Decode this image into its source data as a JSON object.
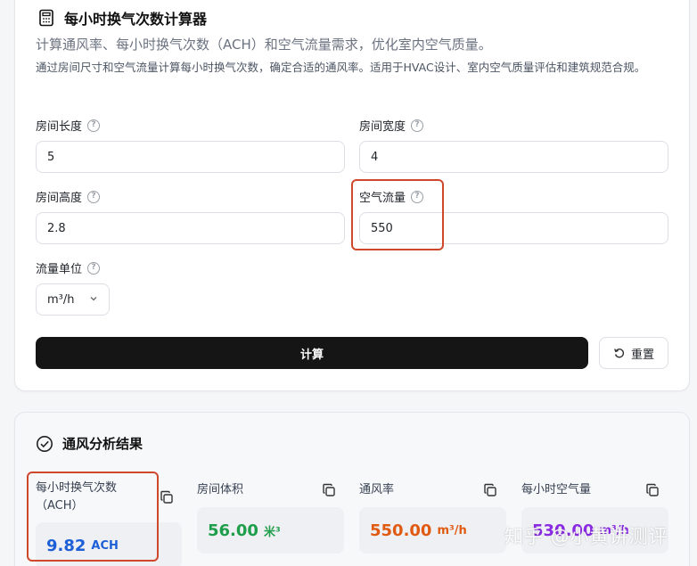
{
  "header": {
    "title": "每小时换气次数计算器",
    "subtitle": "计算通风率、每小时换气次数（ACH）和空气流量需求，优化室内空气质量。",
    "description": "通过房间尺寸和空气流量计算每小时换气次数，确定合适的通风率。适用于HVAC设计、室内空气质量评估和建筑规范合规。"
  },
  "form": {
    "length": {
      "label": "房间长度",
      "value": "5"
    },
    "width": {
      "label": "房间宽度",
      "value": "4"
    },
    "height": {
      "label": "房间高度",
      "value": "2.8"
    },
    "airflow": {
      "label": "空气流量",
      "value": "550"
    },
    "unit": {
      "label": "流量单位",
      "value": "m³/h"
    },
    "calculate_label": "计算",
    "reset_label": "重置"
  },
  "results": {
    "title": "通风分析结果",
    "ach": {
      "label": "每小时换气次数（ACH）",
      "value": "9.82",
      "unit": "ACH",
      "color": "#1d5fd6"
    },
    "volume": {
      "label": "房间体积",
      "value": "56.00",
      "unit": "米³",
      "color": "#1e9e4a"
    },
    "rate": {
      "label": "通风率",
      "value": "550.00",
      "unit": "m³/h",
      "color": "#e05a12"
    },
    "hourly": {
      "label": "每小时空气量",
      "value": "530.00",
      "unit": "m³/h",
      "color": "#8a2be2"
    }
  },
  "watermark": "知乎 @小黄讲测评",
  "icons": {
    "title": "calculator-icon",
    "help": "question-circle-icon",
    "reset": "rotate-ccw-icon",
    "section": "check-circle-icon",
    "copy": "copy-icon"
  },
  "colors": {
    "highlight": "#d0482b",
    "primary_button": "#151515"
  }
}
